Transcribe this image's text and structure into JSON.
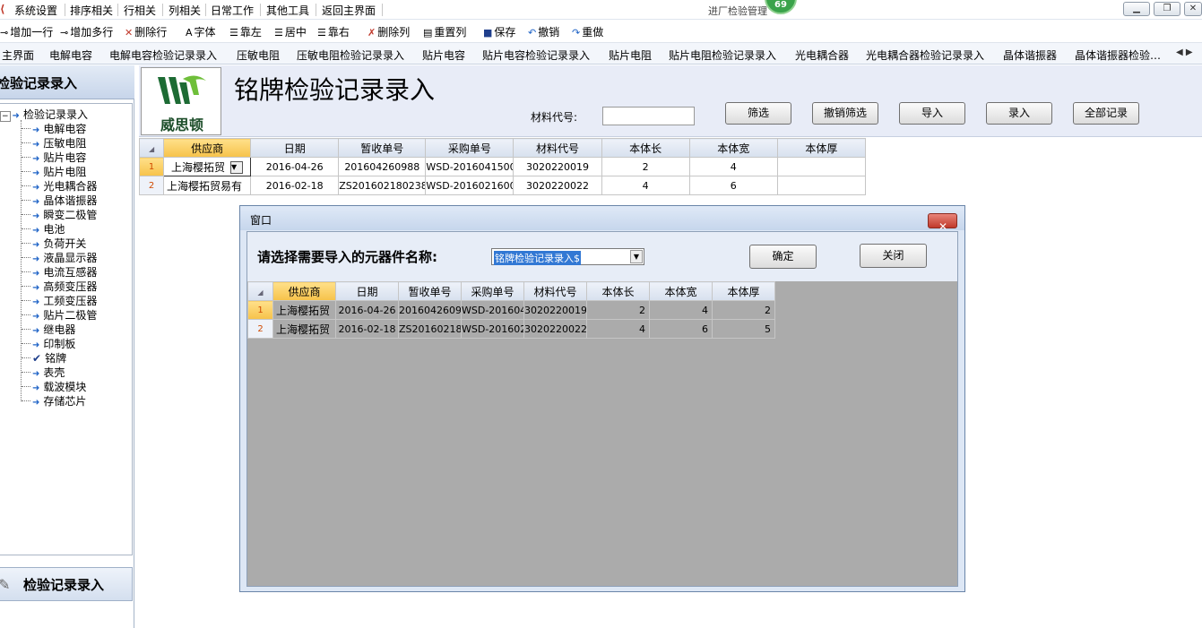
{
  "menu": {
    "items": [
      "系统设置",
      "排序相关",
      "行相关",
      "列相关",
      "日常工作",
      "其他工具",
      "返回主界面"
    ],
    "app_title": "进厂检验管理",
    "badge": "69"
  },
  "toolbar": {
    "items": [
      {
        "label": "增加一行",
        "icon": "add-row-icon"
      },
      {
        "label": "增加多行",
        "icon": "add-rows-icon"
      },
      {
        "label": "删除行",
        "icon": "delete-row-icon"
      },
      {
        "label": "字体",
        "icon": "font-icon"
      },
      {
        "label": "靠左",
        "icon": "align-left-icon"
      },
      {
        "label": "居中",
        "icon": "align-center-icon"
      },
      {
        "label": "靠右",
        "icon": "align-right-icon"
      },
      {
        "label": "删除列",
        "icon": "delete-column-icon"
      },
      {
        "label": "重置列",
        "icon": "reset-column-icon"
      },
      {
        "label": "保存",
        "icon": "save-icon"
      },
      {
        "label": "撤销",
        "icon": "undo-icon"
      },
      {
        "label": "重做",
        "icon": "redo-icon"
      }
    ]
  },
  "tabs": [
    "主界面",
    "电解电容",
    "电解电容检验记录录入",
    "压敏电阻",
    "压敏电阻检验记录录入",
    "贴片电容",
    "贴片电容检验记录录入",
    "贴片电阻",
    "贴片电阻检验记录录入",
    "光电耦合器",
    "光电耦合器检验记录录入",
    "晶体谐振器",
    "晶体谐振器检验…"
  ],
  "sidebar": {
    "header": "检验记录录入",
    "tree_root": "检验记录录入",
    "tree_items": [
      "电解电容",
      "压敏电阻",
      "贴片电容",
      "贴片电阻",
      "光电耦合器",
      "晶体谐振器",
      "瞬变二极管",
      "电池",
      "负荷开关",
      "液晶显示器",
      "电流互感器",
      "高频变压器",
      "工频变压器",
      "贴片二极管",
      "继电器",
      "印制板",
      "铭牌",
      "表壳",
      "载波模块",
      "存储芯片"
    ],
    "checked_item": "铭牌",
    "footer": "检验记录录入"
  },
  "header": {
    "logo_text": "威思顿",
    "title": "铭牌检验记录录入",
    "material_label": "材料代号:",
    "material_value": "",
    "buttons": [
      "筛选",
      "撤销筛选",
      "导入",
      "录入",
      "全部记录"
    ]
  },
  "main_grid": {
    "columns": [
      "供应商",
      "日期",
      "暂收单号",
      "采购单号",
      "材料代号",
      "本体长",
      "本体宽",
      "本体厚"
    ],
    "rows": [
      [
        "1",
        "上海樱拓贸",
        "2016-04-26",
        "201604260988",
        "WSD-2016041500",
        "3020220019",
        "2",
        "4",
        ""
      ],
      [
        "2",
        "上海樱拓贸易有",
        "2016-02-18",
        "ZS201602180238",
        "WSD-2016021600",
        "3020220022",
        "4",
        "6",
        ""
      ]
    ]
  },
  "dialog": {
    "title": "窗口",
    "prompt": "请选择需要导入的元器件名称:",
    "combo_value": "铭牌检验记录录入$",
    "ok_label": "确定",
    "close_label": "关闭",
    "columns": [
      "供应商",
      "日期",
      "暂收单号",
      "采购单号",
      "材料代号",
      "本体长",
      "本体宽",
      "本体厚"
    ],
    "rows": [
      [
        "1",
        "上海樱拓贸",
        "2016-04-26",
        "2016042609",
        "WSD-201604",
        "3020220019",
        "2",
        "4",
        "2"
      ],
      [
        "2",
        "上海樱拓贸",
        "2016-02-18",
        "ZS20160218",
        "WSD-201602",
        "3020220022",
        "4",
        "6",
        "5"
      ]
    ]
  }
}
